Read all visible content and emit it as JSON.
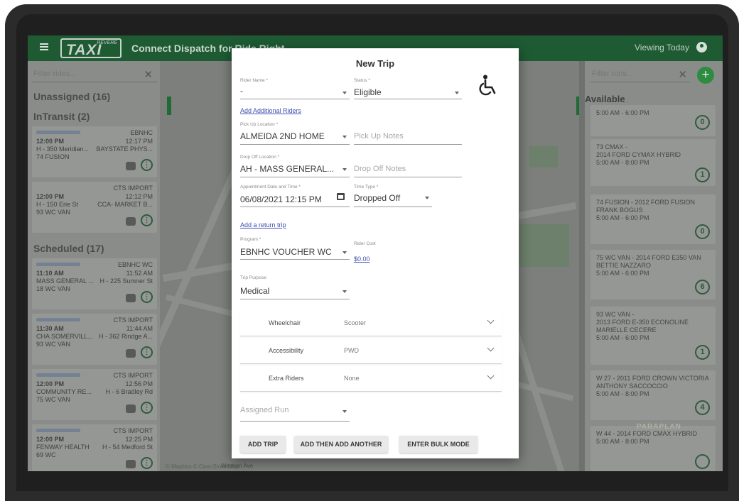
{
  "app": {
    "logo_text": "TAXI",
    "logo_sub": "REVERE",
    "title": "Connect Dispatch for Ride Right",
    "viewing": "Viewing Today"
  },
  "left_panel": {
    "filter_placeholder": "Filter rides...",
    "sections": {
      "unassigned": "Unassigned (16)",
      "intransit": "InTransit (2)",
      "scheduled": "Scheduled (17)"
    },
    "intransit_cards": [
      {
        "agency": "EBNHC",
        "time": "12:00 PM",
        "time_right": "12:17 PM",
        "pickup": "H - 350 Meridian...",
        "dropoff": "BAYSTATE PHYS...",
        "vehicle": "74 FUSION"
      },
      {
        "agency": "CTS IMPORT",
        "time": "12:00 PM",
        "time_right": "12:12 PM",
        "pickup": "H - 150 Erie St",
        "dropoff": "CCA- MARKET B...",
        "vehicle": "93 WC VAN"
      }
    ],
    "scheduled_cards": [
      {
        "agency": "EBNHC WC",
        "time": "11:10 AM",
        "time_right": "11:52 AM",
        "pickup": "MASS GENERAL ...",
        "dropoff": "H - 225 Sumner St",
        "vehicle": "18 WC VAN"
      },
      {
        "agency": "CTS IMPORT",
        "time": "11:30 AM",
        "time_right": "11:44 AM",
        "pickup": "CHA SOMERVILL...",
        "dropoff": "H - 362 Rindge A...",
        "vehicle": "93 WC VAN"
      },
      {
        "agency": "CTS IMPORT",
        "time": "12:00 PM",
        "time_right": "12:56 PM",
        "pickup": "COMMUNITY RE...",
        "dropoff": "H - 6 Bradley Rd",
        "vehicle": "75 WC VAN"
      },
      {
        "agency": "CTS IMPORT",
        "time": "12:00 PM",
        "time_right": "12:25 PM",
        "pickup": "FENWAY HEALTH",
        "dropoff": "H - 54 Medford St",
        "vehicle": "69 WC"
      }
    ]
  },
  "map": {
    "credit": "© Mapbox © OpenStreetMap",
    "street": "Western Ave"
  },
  "right_panel": {
    "filter_placeholder": "Filter runs...",
    "available": "Available",
    "runs": [
      {
        "title": "",
        "subtitle": "",
        "hours": "5:00 AM - 6:00 PM",
        "count": "0"
      },
      {
        "title": "73 CMAX -",
        "subtitle": "2014 FORD CYMAX HYBRID",
        "hours": "5:00 AM - 8:00 PM",
        "count": "1"
      },
      {
        "title": "74 FUSION - 2012 FORD FUSION",
        "subtitle": "FRANK BOGUS",
        "hours": "5:00 AM - 6:00 PM",
        "count": "0"
      },
      {
        "title": "75 WC VAN - 2014 FORD E350 VAN",
        "subtitle": "BETTIE NAZZARO",
        "hours": "5:00 AM - 6:00 PM",
        "count": "6"
      },
      {
        "title": "93 WC VAN -",
        "subtitle": "2013 FORD E-350 ECONOLINE",
        "extra": "MARIELLE CECERE",
        "hours": "5:00 AM - 6:00 PM",
        "count": "1"
      },
      {
        "title": "W 27 - 2011 FORD CROWN VICTORIA",
        "subtitle": "ANTHONY SACCOCCIO",
        "hours": "5:00 AM - 8:00 PM",
        "count": "4"
      },
      {
        "title": "W 44 - 2014 FORD CMAX HYBRID",
        "subtitle": "",
        "hours": "5:00 AM - 8:00 PM",
        "count": ""
      }
    ],
    "brand": "PARAPLAN"
  },
  "modal": {
    "title": "New Trip",
    "rider_name_label": "Rider Name *",
    "rider_name_value": "-",
    "status_label": "Status *",
    "status_value": "Eligible",
    "add_riders_link": "Add Additional Riders",
    "pickup_label": "Pick Up Location *",
    "pickup_value": "ALMEIDA 2ND HOME",
    "pickup_notes_placeholder": "Pick Up Notes",
    "dropoff_label": "Drop Off Location *",
    "dropoff_value": "AH - MASS GENERAL...",
    "dropoff_notes_placeholder": "Drop Off Notes",
    "appt_label": "Appointment Date and Time *",
    "appt_value": "06/08/2021 12:15 PM",
    "timetype_label": "Time Type *",
    "timetype_value": "Dropped Off",
    "return_link": "Add a return trip",
    "program_label": "Program *",
    "program_value": "EBNHC VOUCHER WC",
    "rider_cost_label": "Rider Cost",
    "rider_cost_value": "$0.00",
    "purpose_label": "Trip Purpose",
    "purpose_value": "Medical",
    "accordions": [
      {
        "name": "Wheelchair",
        "value": "Scooter"
      },
      {
        "name": "Accessibility",
        "value": "PWD"
      },
      {
        "name": "Extra Riders",
        "value": "None"
      }
    ],
    "assigned_run_placeholder": "Assigned Run",
    "buttons": {
      "add_trip": "ADD TRIP",
      "add_another": "ADD THEN ADD ANOTHER",
      "bulk": "ENTER BULK MODE"
    }
  }
}
